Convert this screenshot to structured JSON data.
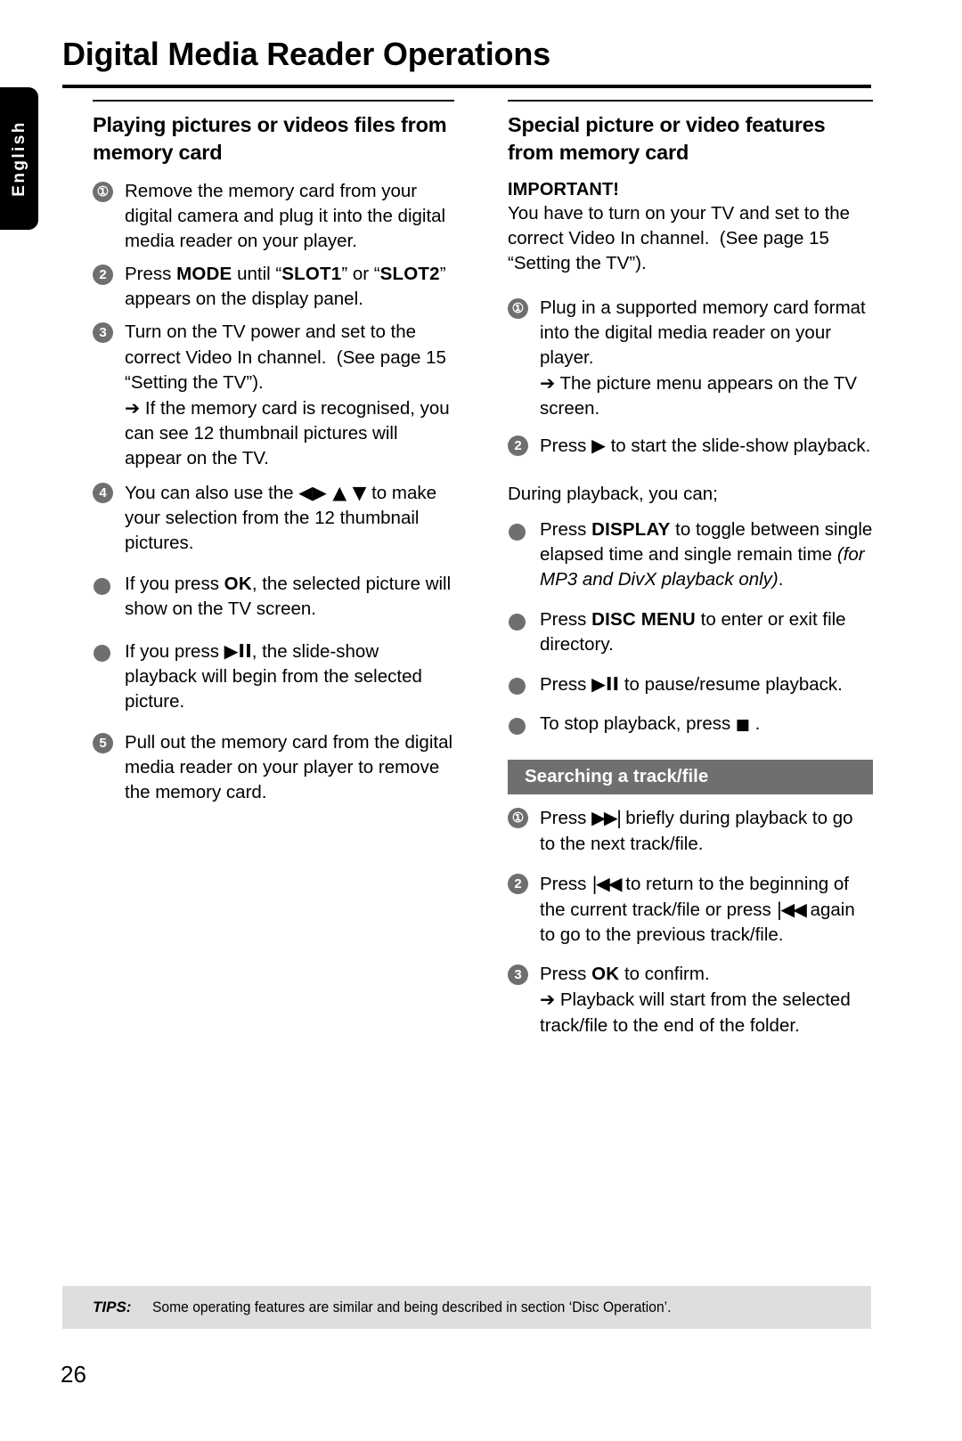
{
  "language_tab": {
    "label": "English"
  },
  "header": {
    "title": "Digital Media Reader Operations"
  },
  "left_column": {
    "heading": "Playing pictures or videos files from memory card",
    "steps": [
      {
        "marker": "1",
        "text": "Remove the memory card from your digital camera and plug it into the digital media reader on your player."
      },
      {
        "marker": "2",
        "text": "Press MODE until “SLOT1” or “SLOT2”  appears on the display panel."
      },
      {
        "marker": "3",
        "text": "Turn on the TV power and set to the correct Video In channel.  (See page 15 “Setting the TV”).",
        "sub": "→ If the memory card is recognised, you can see 12 thumbnail pictures will appear on the TV."
      },
      {
        "marker": "4",
        "text": "You can also use the ◀▶ ▲ ▼ to make your selection from the 12 thumbnail pictures."
      }
    ],
    "bullets": [
      {
        "text": "If you press OK, the selected picture will show on the TV screen."
      },
      {
        "text": "If you press ▶II, the slide-show playback will begin from the selected picture."
      }
    ],
    "final_step": {
      "marker": "5",
      "text": "Pull out the memory card from the digital media reader on your player to remove the memory card."
    }
  },
  "right_column": {
    "heading": "Special picture or video features from memory card",
    "important_title": "IMPORTANT!",
    "important_text": "You have to turn on your TV and set to the correct Video In channel.  (See page 15 “Setting the TV”).",
    "steps": [
      {
        "marker": "1",
        "text": "Plug in a supported memory card format into the digital media reader on your player.",
        "sub": "→ The picture menu appears on the TV screen."
      },
      {
        "marker": "2",
        "text": "Press ▶ to start the slide-show playback."
      }
    ],
    "during_playback_label": "During playback, you can;",
    "playback_bullets": [
      {
        "text": "Press DISPLAY to toggle between single elapsed time and single remain time (for MP3 and DivX playback only)."
      },
      {
        "text": "Press DISC MENU to enter or exit file directory."
      },
      {
        "text": "Press ▶II to pause/resume playback."
      },
      {
        "text": "To stop playback, press ■ ."
      }
    ],
    "search_section": {
      "bar_label": "Searching a track/file",
      "steps": [
        {
          "marker": "1",
          "text": "Press ▶▶| briefly during playback to go to the next track/file."
        },
        {
          "marker": "2",
          "text": "Press |◀◀ to return to the beginning of the current track/file or press |◀◀ again to go to the previous track/file."
        },
        {
          "marker": "3",
          "text": "Press OK to confirm.",
          "sub": "→ Playback will start from the selected track/file to the end of the folder."
        }
      ]
    }
  },
  "footer": {
    "tips_label": "TIPS:",
    "tips_text": "Some operating features are similar and being described in section ‘Disc Operation’.",
    "page_number": "26"
  },
  "colors": {
    "marker_gray": "#6f6f6f",
    "tips_gray": "#dedede",
    "tab_black": "#000000"
  }
}
